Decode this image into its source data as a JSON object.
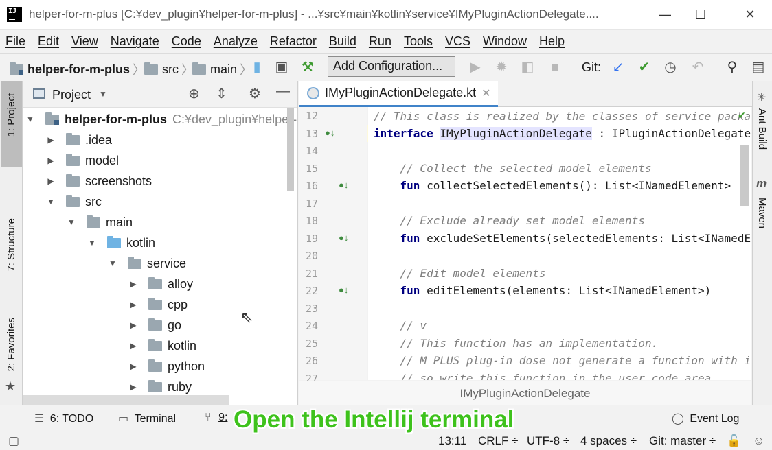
{
  "window": {
    "title": "helper-for-m-plus [C:¥dev_plugin¥helper-for-m-plus] - ...¥src¥main¥kotlin¥service¥IMyPluginActionDelegate....",
    "app_icon_text": "IJ"
  },
  "menu": [
    "File",
    "Edit",
    "View",
    "Navigate",
    "Code",
    "Analyze",
    "Refactor",
    "Build",
    "Run",
    "Tools",
    "VCS",
    "Window",
    "Help"
  ],
  "navbar": {
    "crumbs": [
      "helper-for-m-plus",
      "src",
      "main"
    ],
    "add_config": "Add Configuration...",
    "git_label": "Git:"
  },
  "left_strip": {
    "project_tab": "1: Project",
    "structure_tab": "7: Structure",
    "favorites_tab": "2: Favorites"
  },
  "project_panel": {
    "title": "Project",
    "root": {
      "name": "helper-for-m-plus",
      "path": "C:¥dev_plugin¥helper-for-m-plus"
    },
    "items": [
      ".idea",
      "model",
      "screenshots",
      "src",
      "main",
      "kotlin",
      "service",
      "alloy",
      "cpp",
      "go",
      "kotlin",
      "python",
      "ruby"
    ]
  },
  "editor": {
    "tab_label": "IMyPluginActionDelegate.kt",
    "breadcrumb": "IMyPluginActionDelegate",
    "line_numbers": [
      "12",
      "13",
      "14",
      "15",
      "16",
      "17",
      "18",
      "19",
      "20",
      "21",
      "22",
      "23",
      "24",
      "25",
      "26",
      "27"
    ],
    "lines": {
      "l12": "// This class is realized by the classes of service package",
      "l13_kw": "interface",
      "l13_name": "IMyPluginActionDelegate",
      "l13_rest": " : IPluginActionDelegate {",
      "l15": "    // Collect the selected model elements",
      "l16_kw": "    fun",
      "l16_rest": " collectSelectedElements(): List<INamedElement>",
      "l18": "    // Exclude already set model elements",
      "l19_kw": "    fun",
      "l19_rest": " excludeSetElements(selectedElements: List<INamedEleme",
      "l21": "    // Edit model elements",
      "l22_kw": "    fun",
      "l22_rest": " editElements(elements: List<INamedElement>)",
      "l24": "    // v",
      "l25": "    // This function has an implementation.",
      "l26": "    // M PLUS plug-in dose not generate a function with imple",
      "l27": "    // so write this function in the user code area"
    }
  },
  "right_strip": {
    "ant_build": "Ant Build",
    "maven": "Maven"
  },
  "bottom_bar": {
    "todo_num": "6",
    "todo_label": ": TODO",
    "terminal": "Terminal",
    "vcs_num": "9:",
    "event_log": "Event Log"
  },
  "status_bar": {
    "position": "13:11",
    "line_sep": "CRLF ÷",
    "encoding": "UTF-8 ÷",
    "indent": "4 spaces ÷",
    "git_branch": "Git: master ÷"
  },
  "caption": "Open the Intellij terminal",
  "colors": {
    "accent_tab": "#4083c9",
    "caption_green": "#3ec21c",
    "folder_blue": "#6fb3e3",
    "folder_gray": "#9aa7b0"
  }
}
